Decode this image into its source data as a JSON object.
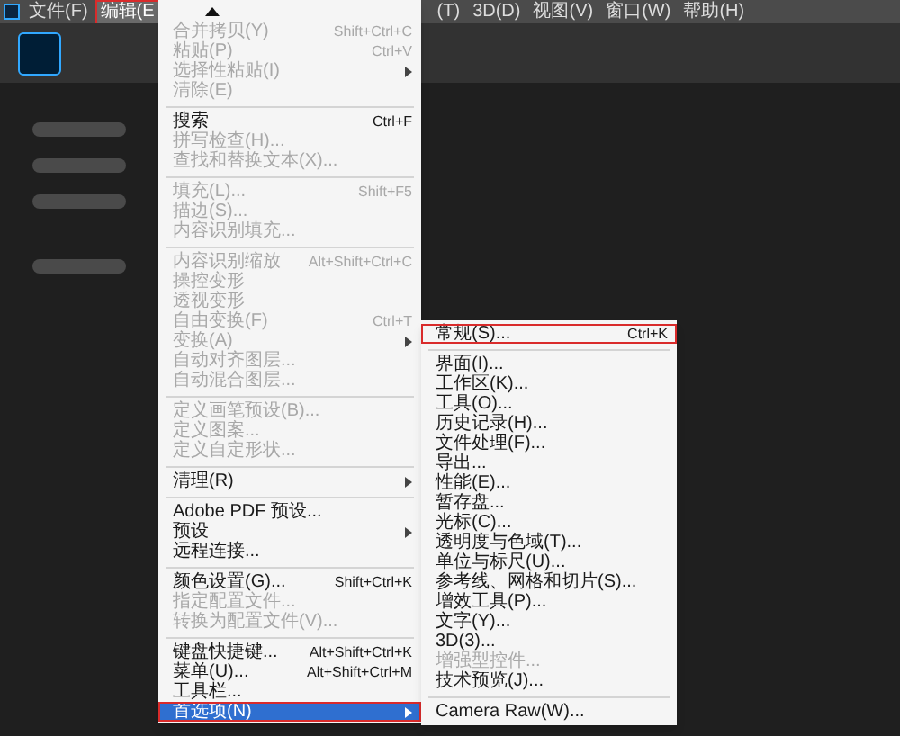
{
  "menu_bar": {
    "items": [
      {
        "label": "文件(F)",
        "selected": false
      },
      {
        "label": "编辑(E",
        "selected": true,
        "annotated": true
      },
      {
        "label": "(T)",
        "selected": false
      },
      {
        "label": "3D(D)",
        "selected": false
      },
      {
        "label": "视图(V)",
        "selected": false
      },
      {
        "label": "窗口(W)",
        "selected": false
      },
      {
        "label": "帮助(H)",
        "selected": false
      }
    ]
  },
  "edit_menu": {
    "items": [
      {
        "kind": "scroll_arrow"
      },
      {
        "kind": "item",
        "label": "合并拷贝(Y)",
        "shortcut": "Shift+Ctrl+C",
        "disabled": true,
        "selected": false
      },
      {
        "kind": "item",
        "label": "粘贴(P)",
        "shortcut": "Ctrl+V",
        "disabled": true,
        "selected": false
      },
      {
        "kind": "item",
        "label": "选择性粘贴(I)",
        "disabled": true,
        "selected": false,
        "submenu": true
      },
      {
        "kind": "item",
        "label": "清除(E)",
        "disabled": true,
        "selected": false
      },
      {
        "kind": "separator"
      },
      {
        "kind": "item",
        "label": "搜索",
        "shortcut": "Ctrl+F",
        "disabled": false,
        "selected": false
      },
      {
        "kind": "item",
        "label": "拼写检查(H)...",
        "disabled": true,
        "selected": false
      },
      {
        "kind": "item",
        "label": "查找和替换文本(X)...",
        "disabled": true,
        "selected": false
      },
      {
        "kind": "separator"
      },
      {
        "kind": "item",
        "label": "填充(L)...",
        "shortcut": "Shift+F5",
        "disabled": true,
        "selected": false
      },
      {
        "kind": "item",
        "label": "描边(S)...",
        "disabled": true,
        "selected": false
      },
      {
        "kind": "item",
        "label": "内容识别填充...",
        "disabled": true,
        "selected": false
      },
      {
        "kind": "separator"
      },
      {
        "kind": "item",
        "label": "内容识别缩放",
        "shortcut": "Alt+Shift+Ctrl+C",
        "disabled": true,
        "selected": false
      },
      {
        "kind": "item",
        "label": "操控变形",
        "disabled": true,
        "selected": false
      },
      {
        "kind": "item",
        "label": "透视变形",
        "disabled": true,
        "selected": false
      },
      {
        "kind": "item",
        "label": "自由变换(F)",
        "shortcut": "Ctrl+T",
        "disabled": true,
        "selected": false
      },
      {
        "kind": "item",
        "label": "变换(A)",
        "disabled": true,
        "selected": false,
        "submenu": true
      },
      {
        "kind": "item",
        "label": "自动对齐图层...",
        "disabled": true,
        "selected": false
      },
      {
        "kind": "item",
        "label": "自动混合图层...",
        "disabled": true,
        "selected": false
      },
      {
        "kind": "separator"
      },
      {
        "kind": "item",
        "label": "定义画笔预设(B)...",
        "disabled": true,
        "selected": false
      },
      {
        "kind": "item",
        "label": "定义图案...",
        "disabled": true,
        "selected": false
      },
      {
        "kind": "item",
        "label": "定义自定形状...",
        "disabled": true,
        "selected": false
      },
      {
        "kind": "separator"
      },
      {
        "kind": "item",
        "label": "清理(R)",
        "disabled": false,
        "selected": false,
        "submenu": true
      },
      {
        "kind": "separator"
      },
      {
        "kind": "item",
        "label": "Adobe PDF 预设...",
        "disabled": false,
        "selected": false
      },
      {
        "kind": "item",
        "label": "预设",
        "disabled": false,
        "selected": false,
        "submenu": true
      },
      {
        "kind": "item",
        "label": "远程连接...",
        "disabled": false,
        "selected": false
      },
      {
        "kind": "separator"
      },
      {
        "kind": "item",
        "label": "颜色设置(G)...",
        "shortcut": "Shift+Ctrl+K",
        "disabled": false,
        "selected": false
      },
      {
        "kind": "item",
        "label": "指定配置文件...",
        "disabled": true,
        "selected": false
      },
      {
        "kind": "item",
        "label": "转换为配置文件(V)...",
        "disabled": true,
        "selected": false
      },
      {
        "kind": "separator"
      },
      {
        "kind": "item",
        "label": "键盘快捷键...",
        "shortcut": "Alt+Shift+Ctrl+K",
        "disabled": false,
        "selected": false
      },
      {
        "kind": "item",
        "label": "菜单(U)...",
        "shortcut": "Alt+Shift+Ctrl+M",
        "disabled": false,
        "selected": false
      },
      {
        "kind": "item",
        "label": "工具栏...",
        "disabled": false,
        "selected": false
      },
      {
        "kind": "item",
        "label": "首选项(N)",
        "disabled": false,
        "selected": true,
        "submenu": true,
        "annotated": true
      }
    ]
  },
  "preferences_menu": {
    "items": [
      {
        "kind": "item",
        "label": "常规(S)...",
        "shortcut": "Ctrl+K",
        "disabled": false,
        "selected": false,
        "annotated": true
      },
      {
        "kind": "separator"
      },
      {
        "kind": "item",
        "label": "界面(I)...",
        "disabled": false,
        "selected": false
      },
      {
        "kind": "item",
        "label": "工作区(K)...",
        "disabled": false,
        "selected": false
      },
      {
        "kind": "item",
        "label": "工具(O)...",
        "disabled": false,
        "selected": false
      },
      {
        "kind": "item",
        "label": "历史记录(H)...",
        "disabled": false,
        "selected": false
      },
      {
        "kind": "item",
        "label": "文件处理(F)...",
        "disabled": false,
        "selected": false
      },
      {
        "kind": "item",
        "label": "导出...",
        "disabled": false,
        "selected": false
      },
      {
        "kind": "item",
        "label": "性能(E)...",
        "disabled": false,
        "selected": false
      },
      {
        "kind": "item",
        "label": "暂存盘...",
        "disabled": false,
        "selected": false
      },
      {
        "kind": "item",
        "label": "光标(C)...",
        "disabled": false,
        "selected": false
      },
      {
        "kind": "item",
        "label": "透明度与色域(T)...",
        "disabled": false,
        "selected": false
      },
      {
        "kind": "item",
        "label": "单位与标尺(U)...",
        "disabled": false,
        "selected": false
      },
      {
        "kind": "item",
        "label": "参考线、网格和切片(S)...",
        "disabled": false,
        "selected": false
      },
      {
        "kind": "item",
        "label": "增效工具(P)...",
        "disabled": false,
        "selected": false
      },
      {
        "kind": "item",
        "label": "文字(Y)...",
        "disabled": false,
        "selected": false
      },
      {
        "kind": "item",
        "label": "3D(3)...",
        "disabled": false,
        "selected": false
      },
      {
        "kind": "item",
        "label": "增强型控件...",
        "disabled": true,
        "selected": false
      },
      {
        "kind": "item",
        "label": "技术预览(J)...",
        "disabled": false,
        "selected": false
      },
      {
        "kind": "separator"
      },
      {
        "kind": "item",
        "label": "Camera Raw(W)...",
        "disabled": false,
        "selected": false
      }
    ]
  }
}
